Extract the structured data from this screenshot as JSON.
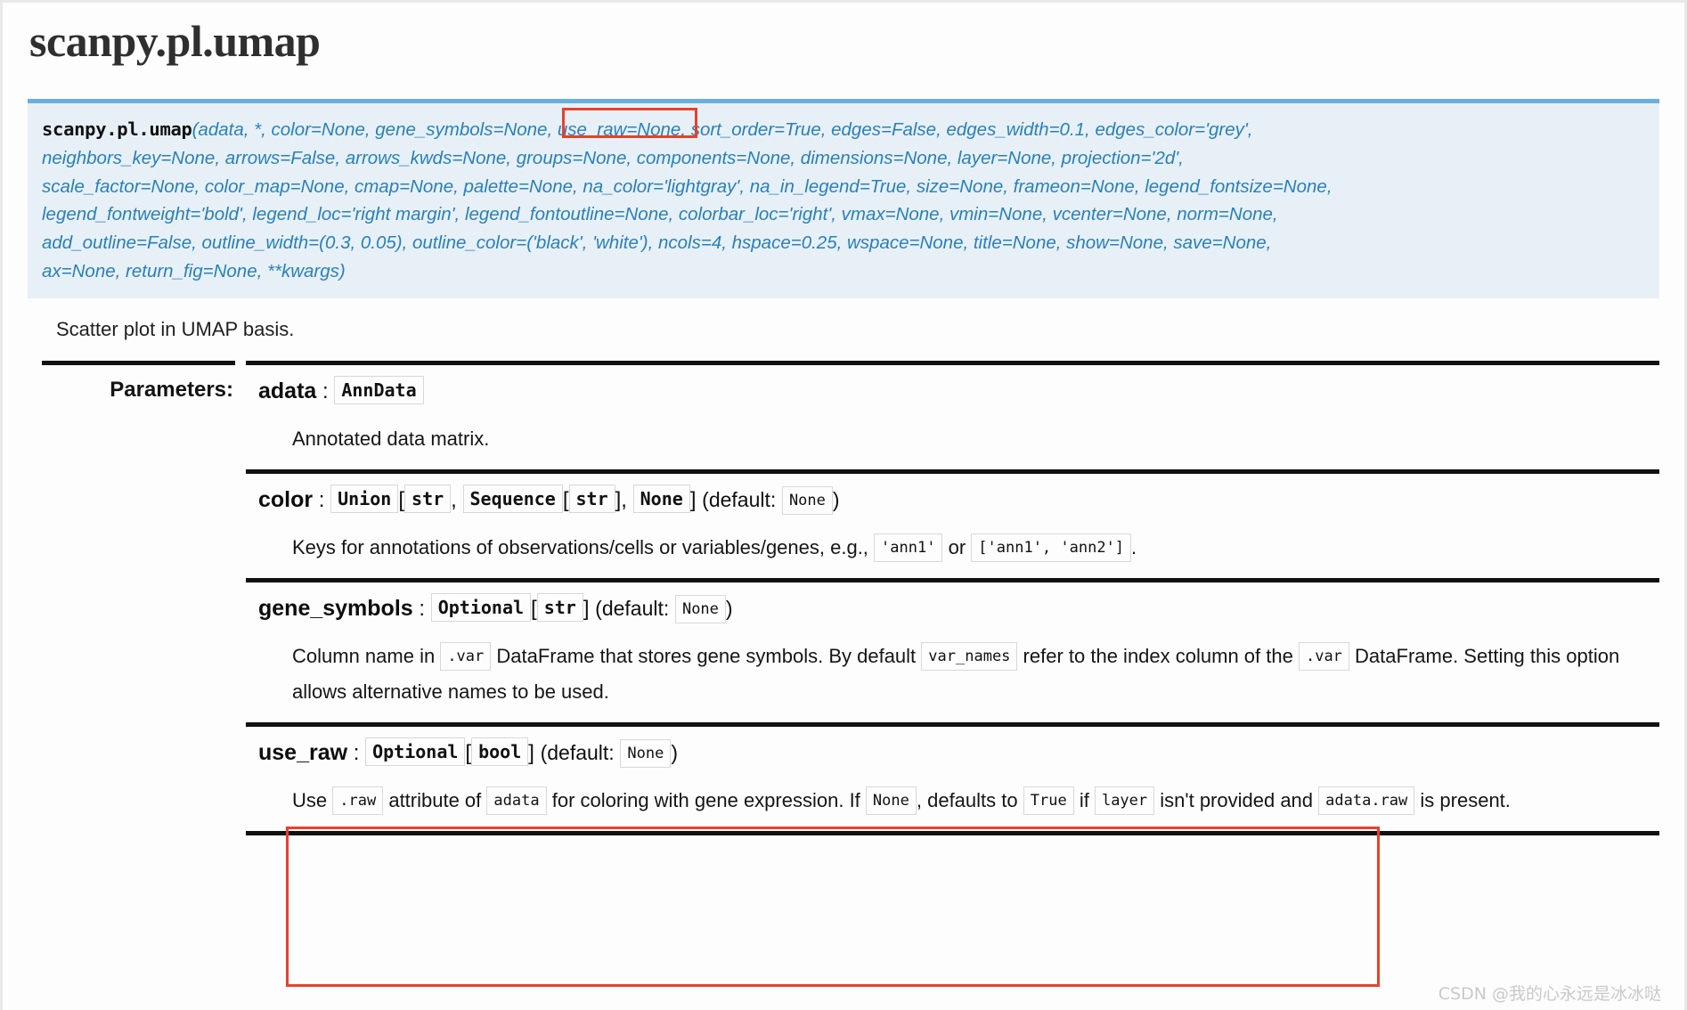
{
  "page": {
    "title": "scanpy.pl.umap",
    "summary": "Scatter plot in UMAP basis."
  },
  "signature": {
    "qualname": "scanpy.pl.umap",
    "open_paren": "(",
    "lines": [
      "adata, *, color=None, gene_symbols=None, use_raw=None, sort_order=True, edges=False, edges_width=0.1, edges_color='grey',",
      "neighbors_key=None, arrows=False, arrows_kwds=None, groups=None, components=None, dimensions=None, layer=None, projection='2d',",
      "scale_factor=None, color_map=None, cmap=None, palette=None, na_color='lightgray', na_in_legend=True, size=None, frameon=None, legend_fontsize=None,",
      "legend_fontweight='bold', legend_loc='right margin', legend_fontoutline=None, colorbar_loc='right', vmax=None, vmin=None, vcenter=None, norm=None,",
      "add_outline=False, outline_width=(0.3, 0.05), outline_color=('black', 'white'), ncols=4, hspace=0.25, wspace=None, title=None, show=None, save=None,",
      "ax=None, return_fig=None, **kwargs)"
    ]
  },
  "fields": {
    "parameters_label": "Parameters:"
  },
  "annotations": {
    "color": "#e8412a",
    "signature_target": "use_raw=None",
    "param_target": "use_raw"
  },
  "params": {
    "adata": {
      "name": "adata",
      "colon": ":",
      "type": "AnnData",
      "desc": "Annotated data matrix."
    },
    "color": {
      "name": "color",
      "colon": ":",
      "t1": "Union",
      "b1": "[",
      "t2": "str",
      "c1": ",",
      "t3": "Sequence",
      "b2": "[",
      "t4": "str",
      "b3": "],",
      "t5": "None",
      "b4": "]",
      "default_open": "(default:",
      "default_val": "None",
      "default_close": ")",
      "desc_1": "Keys for annotations of observations/cells or variables/genes, e.g.,",
      "code_1": "'ann1'",
      "desc_2": "or",
      "code_2": "['ann1', 'ann2']",
      "desc_3": "."
    },
    "gene_symbols": {
      "name": "gene_symbols",
      "colon": ":",
      "t1": "Optional",
      "b1": "[",
      "t2": "str",
      "b2": "]",
      "default_open": "(default:",
      "default_val": "None",
      "default_close": ")",
      "desc_1": "Column name in",
      "code_1": ".var",
      "desc_2": "DataFrame that stores gene symbols. By default",
      "code_2": "var_names",
      "desc_3": "refer to the index column of the",
      "code_3": ".var",
      "desc_4": "DataFrame. Setting this option allows alternative names to be used."
    },
    "use_raw": {
      "name": "use_raw",
      "colon": ":",
      "t1": "Optional",
      "b1": "[",
      "t2": "bool",
      "b2": "]",
      "default_open": "(default:",
      "default_val": "None",
      "default_close": ")",
      "desc_1": "Use",
      "code_1": ".raw",
      "desc_2": "attribute of",
      "code_2": "adata",
      "desc_3": "for coloring with gene expression. If",
      "code_3": "None",
      "desc_4": ", defaults to",
      "code_4": "True",
      "desc_5": "if",
      "code_5": "layer",
      "desc_6": "isn't provided and",
      "code_6": "adata.raw",
      "desc_7": "is present."
    }
  },
  "watermark": "CSDN @我的心永远是冰冰哒"
}
